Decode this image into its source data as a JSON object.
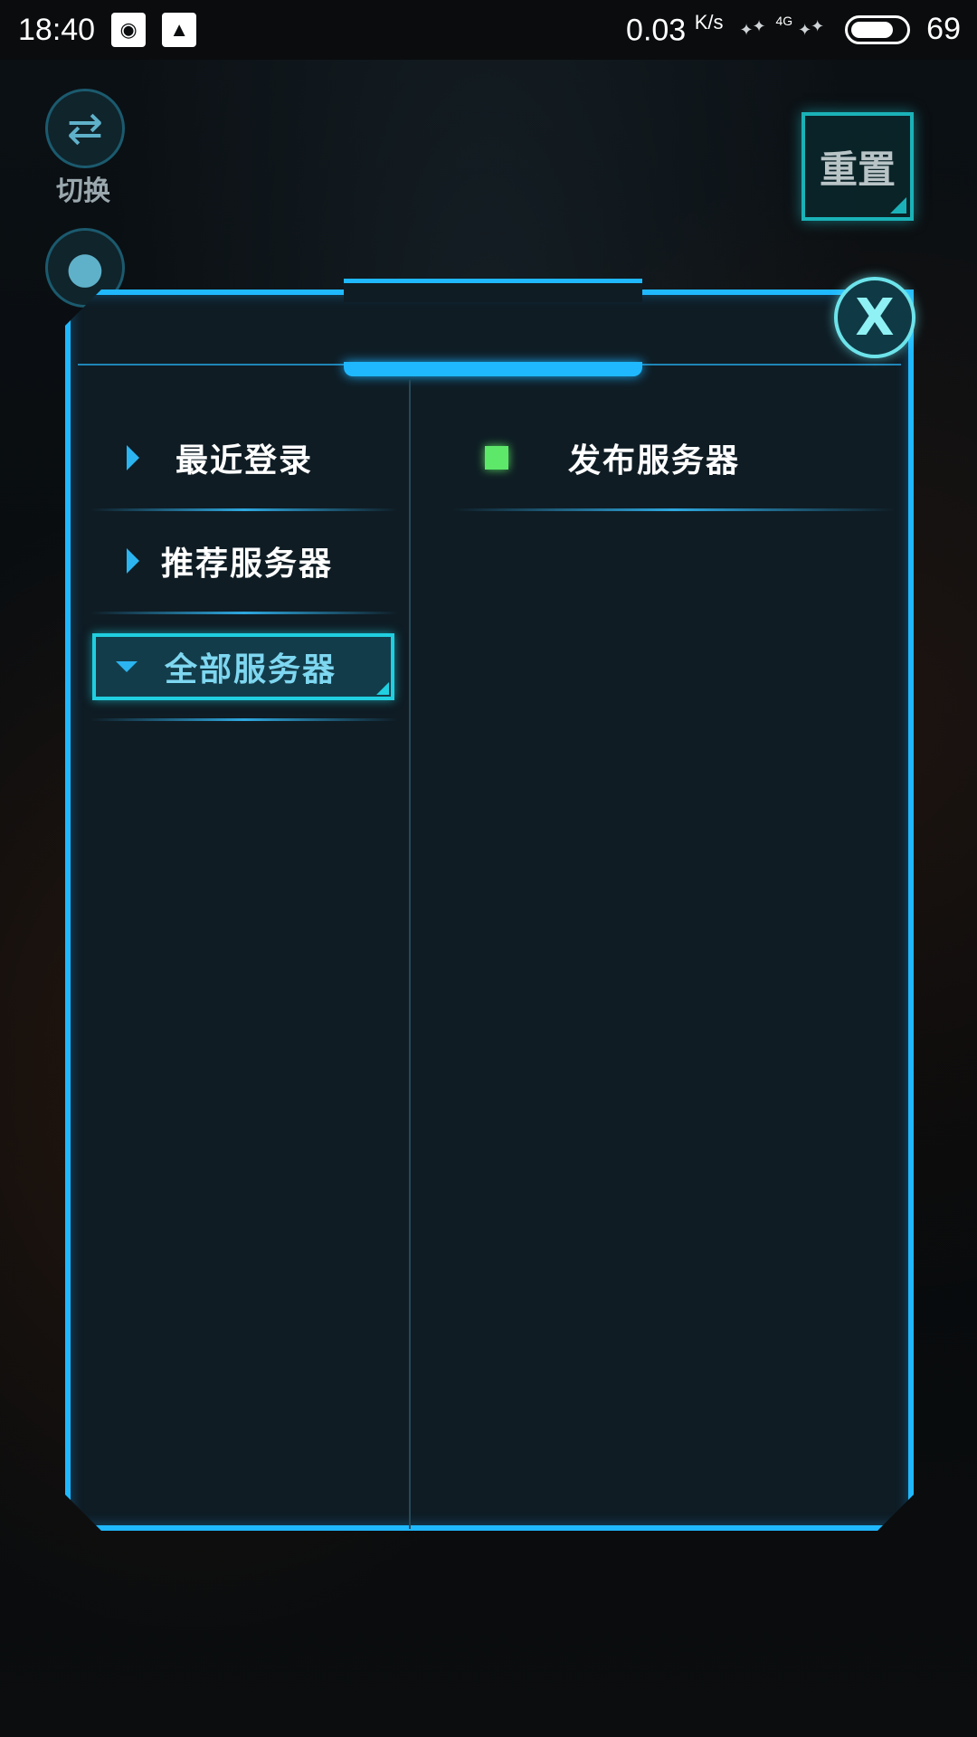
{
  "status_bar": {
    "time": "18:40",
    "net_speed": "0.03",
    "net_unit": "K/s",
    "net_type": "4G",
    "battery": "69",
    "battery_level": 0.69,
    "icons": [
      "qq-icon",
      "gallery-icon"
    ]
  },
  "side_buttons": {
    "switch_label": "切换"
  },
  "reset_button": {
    "label": "重置"
  },
  "dialog": {
    "close_label": "X",
    "menu": [
      {
        "label": "最近登录",
        "active": false
      },
      {
        "label": "推荐服务器",
        "active": false
      },
      {
        "label": "全部服务器",
        "active": true
      }
    ],
    "servers": [
      {
        "name": "发布服务器",
        "status": "online",
        "status_color": "#5de86a"
      }
    ]
  },
  "colors": {
    "accent": "#1fb8ff",
    "active_border": "#20cfe0",
    "panel_bg": "#0f1c24"
  }
}
